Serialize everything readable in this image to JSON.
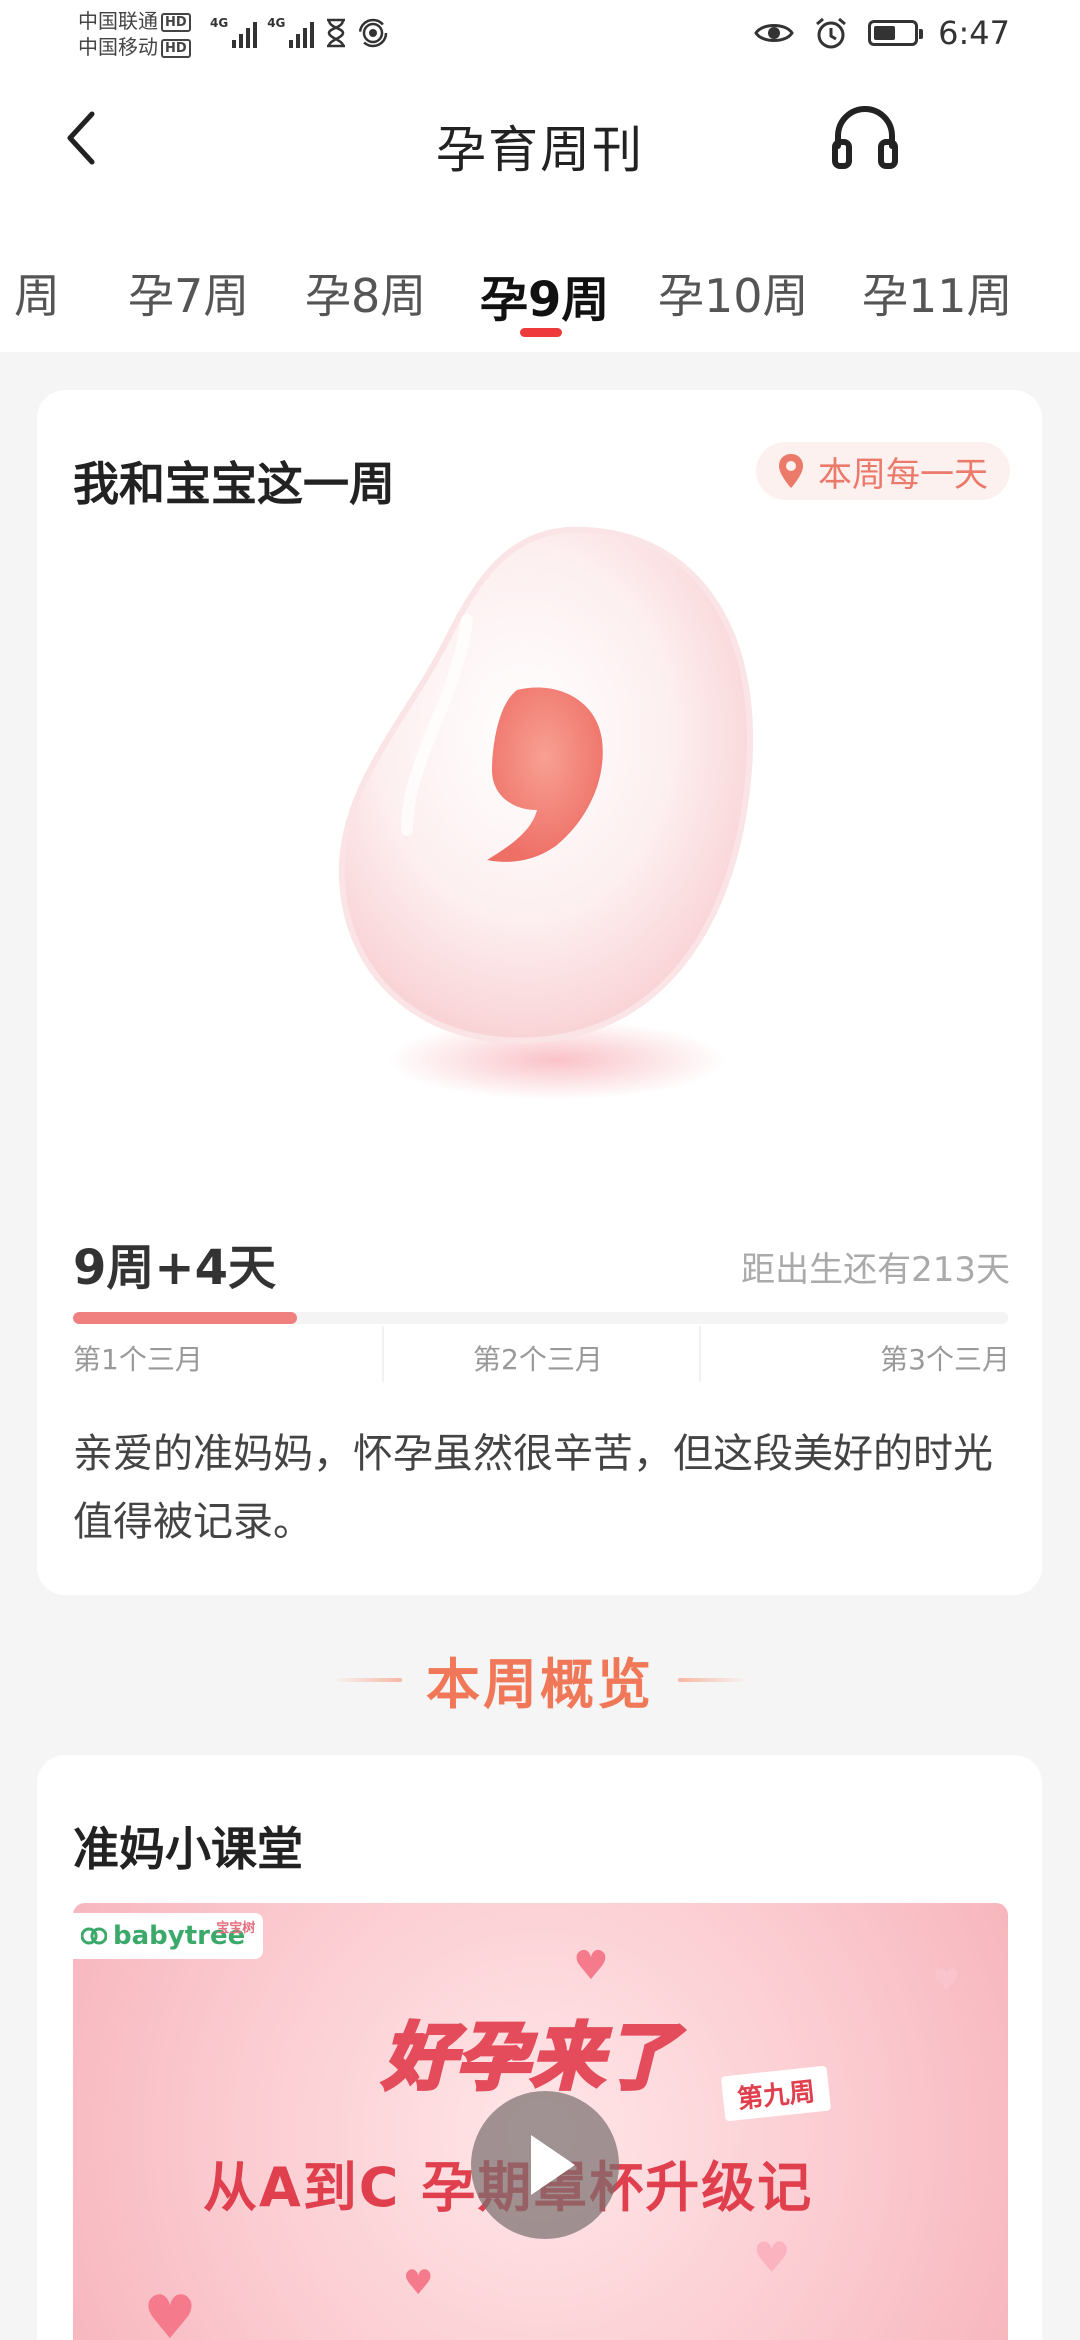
{
  "status_bar": {
    "carrier_1": "中国联通",
    "carrier_2": "中国移动",
    "hd_badge": "HD",
    "network_1": "4G",
    "network_2": "4G",
    "time": "6:47",
    "battery_level_percent": 55
  },
  "header": {
    "title": "孕育周刊"
  },
  "tabs": {
    "items": [
      {
        "label": "周",
        "active": false
      },
      {
        "label": "孕7周",
        "active": false
      },
      {
        "label": "孕8周",
        "active": false
      },
      {
        "label": "孕9周",
        "active": true
      },
      {
        "label": "孕10周",
        "active": false
      },
      {
        "label": "孕11周",
        "active": false
      }
    ],
    "accent_color": "#ee3a3a"
  },
  "week_card": {
    "title": "我和宝宝这一周",
    "daily_button": "本周每一天",
    "week_day": "9周+4天",
    "countdown": "距出生还有213天",
    "progress_fraction": 0.24,
    "trimesters": [
      "第1个三月",
      "第2个三月",
      "第3个三月"
    ],
    "description": "亲爱的准妈妈，怀孕虽然很辛苦，但这段美好的时光值得被记录。"
  },
  "overview": {
    "title": "本周概览"
  },
  "class_card": {
    "title": "准妈小课堂",
    "video": {
      "brand": "babytree",
      "brand_sub": "宝宝树",
      "show_title": "好孕来了",
      "episode_badge": "第九周",
      "episode_title": "从A到C  孕期罩杯升级记"
    }
  },
  "colors": {
    "accent_orange": "#f07858",
    "tab_indicator": "#ee3a3a",
    "progress": "#f08080"
  }
}
